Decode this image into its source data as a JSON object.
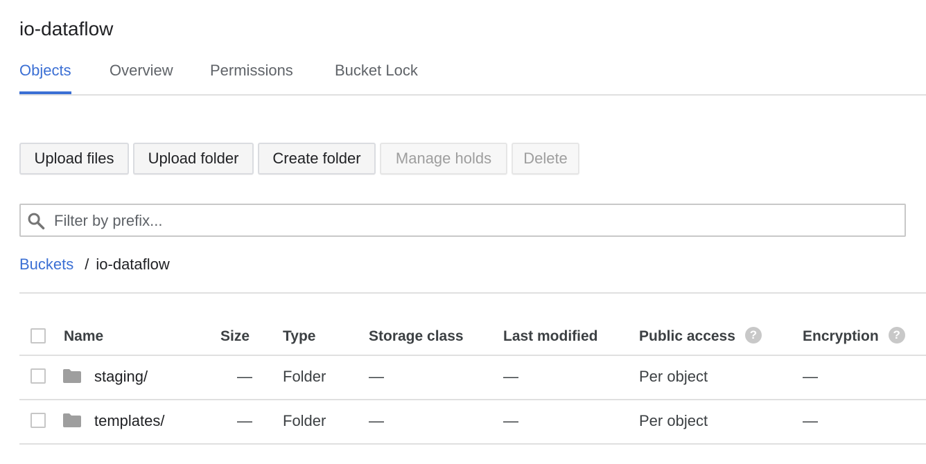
{
  "page": {
    "title": "io-dataflow"
  },
  "tabs": [
    {
      "label": "Objects",
      "active": true
    },
    {
      "label": "Overview",
      "active": false
    },
    {
      "label": "Permissions",
      "active": false
    },
    {
      "label": "Bucket Lock",
      "active": false
    }
  ],
  "toolbar": {
    "upload_files": "Upload files",
    "upload_folder": "Upload folder",
    "create_folder": "Create folder",
    "manage_holds": "Manage holds",
    "delete": "Delete"
  },
  "filter": {
    "placeholder": "Filter by prefix...",
    "value": "",
    "icon": "search-icon"
  },
  "breadcrumb": {
    "root": "Buckets",
    "separator": "/",
    "current": "io-dataflow"
  },
  "table": {
    "columns": {
      "name": "Name",
      "size": "Size",
      "type": "Type",
      "storage_class": "Storage class",
      "last_modified": "Last modified",
      "public_access": "Public access",
      "encryption": "Encryption"
    },
    "help_glyph": "?",
    "rows": [
      {
        "name": "staging/",
        "size": "—",
        "type": "Folder",
        "storage_class": "—",
        "last_modified": "—",
        "public_access": "Per object",
        "encryption": "—"
      },
      {
        "name": "templates/",
        "size": "—",
        "type": "Folder",
        "storage_class": "—",
        "last_modified": "—",
        "public_access": "Per object",
        "encryption": "—"
      }
    ]
  },
  "colors": {
    "accent": "#3b6fd4",
    "text": "#202124",
    "muted": "#5f6368",
    "divider": "#e0e0e0",
    "disabled": "#9e9e9e",
    "folder": "#9e9e9e"
  }
}
